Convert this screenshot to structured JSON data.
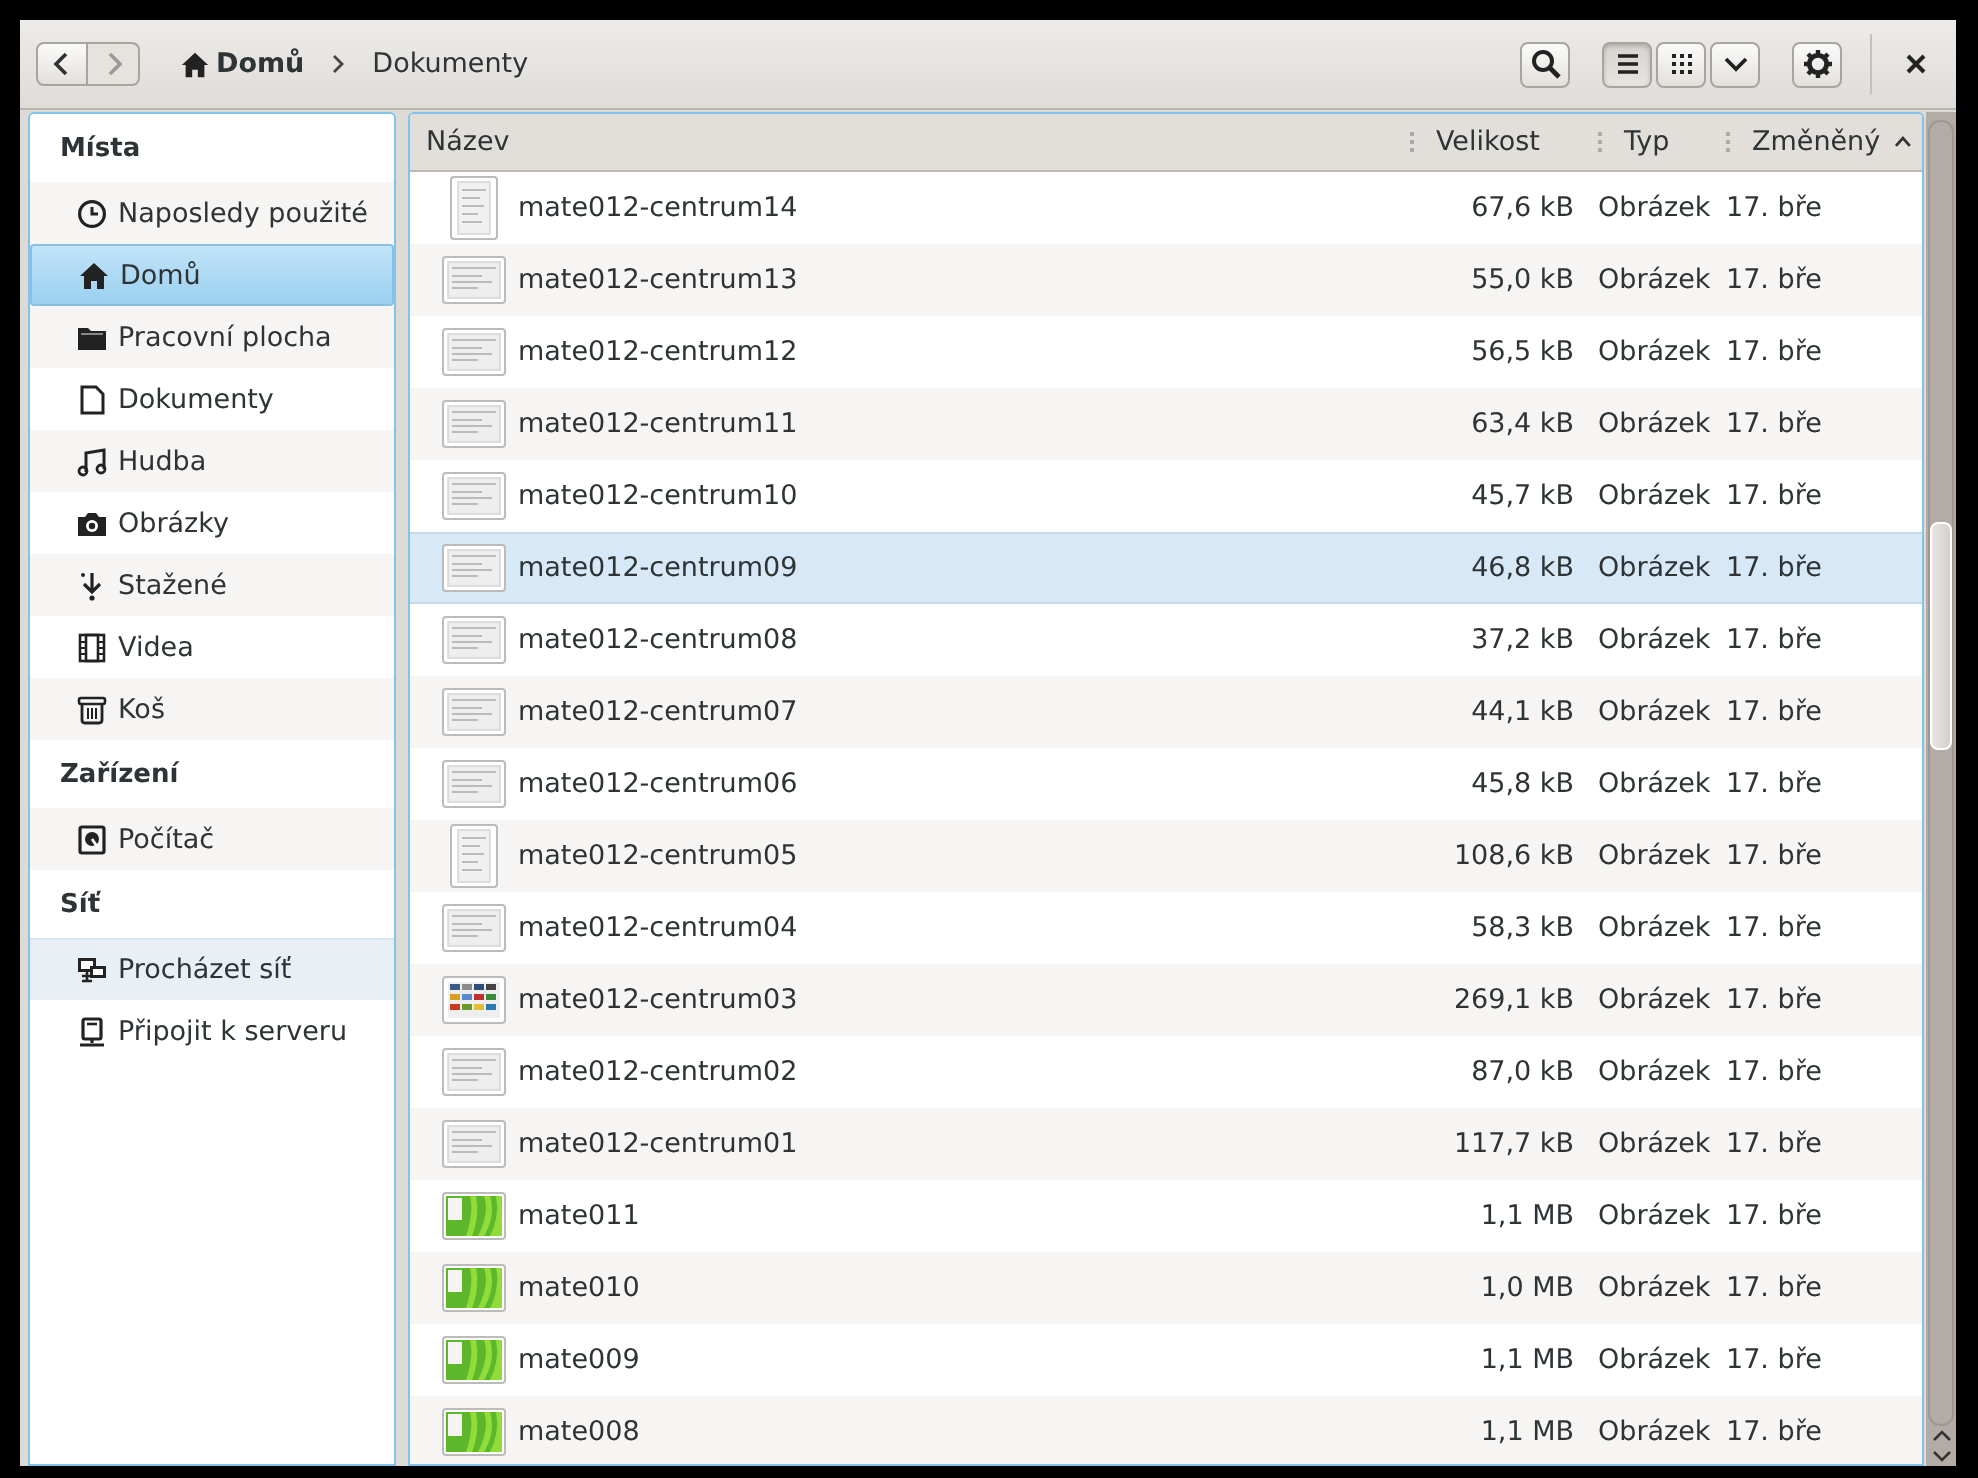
{
  "header": {
    "back": {
      "disabled": false
    },
    "forward": {
      "disabled": true
    },
    "path": [
      {
        "label": "Domů",
        "kind": "home",
        "selected": true
      },
      {
        "label": "Dokumenty",
        "kind": "folder",
        "selected": false
      }
    ],
    "tools": [
      {
        "kind": "search",
        "selected": false
      },
      {
        "kind": "list",
        "selected": true
      },
      {
        "kind": "grid",
        "selected": false
      },
      {
        "kind": "menu",
        "selected": false
      },
      {
        "kind": "gear",
        "selected": false
      }
    ],
    "close": {
      "kind": "close"
    }
  },
  "sidebar": {
    "sections": [
      {
        "title": "Místa",
        "items": [
          {
            "label": "Naposledy použité",
            "kind": "clock",
            "selected": false,
            "hover": false
          },
          {
            "label": "Domů",
            "kind": "home",
            "selected": true,
            "hover": false
          },
          {
            "label": "Pracovní plocha",
            "kind": "folder",
            "selected": false,
            "hover": false
          },
          {
            "label": "Dokumenty",
            "kind": "document",
            "selected": false,
            "hover": false
          },
          {
            "label": "Hudba",
            "kind": "music",
            "selected": false,
            "hover": false
          },
          {
            "label": "Obrázky",
            "kind": "camera",
            "selected": false,
            "hover": false
          },
          {
            "label": "Stažené",
            "kind": "download",
            "selected": false,
            "hover": false
          },
          {
            "label": "Videa",
            "kind": "film",
            "selected": false,
            "hover": false
          },
          {
            "label": "Koš",
            "kind": "trash",
            "selected": false,
            "hover": false
          }
        ]
      },
      {
        "title": "Zařízení",
        "items": [
          {
            "label": "Počítač",
            "kind": "drive",
            "selected": false,
            "hover": false
          }
        ]
      },
      {
        "title": "Síť",
        "items": [
          {
            "label": "Procházet síť",
            "kind": "network",
            "selected": false,
            "hover": true
          },
          {
            "label": "Připojit k serveru",
            "kind": "server",
            "selected": false,
            "hover": false
          }
        ]
      }
    ]
  },
  "table": {
    "columns": [
      {
        "label": "Název",
        "sorted": false
      },
      {
        "label": "Velikost",
        "sorted": false
      },
      {
        "label": "Typ",
        "sorted": false
      },
      {
        "label": "Změněný",
        "sorted": true
      }
    ],
    "rows": [
      {
        "name": "mate012-centrum14",
        "size": "67,6 kB",
        "type": "Obrázek",
        "modified": "17. bře",
        "kind": "portrait",
        "selected": false
      },
      {
        "name": "mate012-centrum13",
        "size": "55,0 kB",
        "type": "Obrázek",
        "modified": "17. bře",
        "kind": "window",
        "selected": false
      },
      {
        "name": "mate012-centrum12",
        "size": "56,5 kB",
        "type": "Obrázek",
        "modified": "17. bře",
        "kind": "window",
        "selected": false
      },
      {
        "name": "mate012-centrum11",
        "size": "63,4 kB",
        "type": "Obrázek",
        "modified": "17. bře",
        "kind": "window",
        "selected": false
      },
      {
        "name": "mate012-centrum10",
        "size": "45,7 kB",
        "type": "Obrázek",
        "modified": "17. bře",
        "kind": "window",
        "selected": false
      },
      {
        "name": "mate012-centrum09",
        "size": "46,8 kB",
        "type": "Obrázek",
        "modified": "17. bře",
        "kind": "window",
        "selected": true
      },
      {
        "name": "mate012-centrum08",
        "size": "37,2 kB",
        "type": "Obrázek",
        "modified": "17. bře",
        "kind": "window",
        "selected": false
      },
      {
        "name": "mate012-centrum07",
        "size": "44,1 kB",
        "type": "Obrázek",
        "modified": "17. bře",
        "kind": "window",
        "selected": false
      },
      {
        "name": "mate012-centrum06",
        "size": "45,8 kB",
        "type": "Obrázek",
        "modified": "17. bře",
        "kind": "window",
        "selected": false
      },
      {
        "name": "mate012-centrum05",
        "size": "108,6 kB",
        "type": "Obrázek",
        "modified": "17. bře",
        "kind": "portrait",
        "selected": false
      },
      {
        "name": "mate012-centrum04",
        "size": "58,3 kB",
        "type": "Obrázek",
        "modified": "17. bře",
        "kind": "window",
        "selected": false
      },
      {
        "name": "mate012-centrum03",
        "size": "269,1 kB",
        "type": "Obrázek",
        "modified": "17. bře",
        "kind": "colorful",
        "selected": false
      },
      {
        "name": "mate012-centrum02",
        "size": "87,0 kB",
        "type": "Obrázek",
        "modified": "17. bře",
        "kind": "window",
        "selected": false
      },
      {
        "name": "mate012-centrum01",
        "size": "117,7 kB",
        "type": "Obrázek",
        "modified": "17. bře",
        "kind": "window",
        "selected": false
      },
      {
        "name": "mate011",
        "size": "1,1 MB",
        "type": "Obrázek",
        "modified": "17. bře",
        "kind": "green",
        "selected": false
      },
      {
        "name": "mate010",
        "size": "1,0 MB",
        "type": "Obrázek",
        "modified": "17. bře",
        "kind": "green",
        "selected": false
      },
      {
        "name": "mate009",
        "size": "1,1 MB",
        "type": "Obrázek",
        "modified": "17. bře",
        "kind": "green",
        "selected": false
      },
      {
        "name": "mate008",
        "size": "1,1 MB",
        "type": "Obrázek",
        "modified": "17. bře",
        "kind": "green",
        "selected": false
      }
    ]
  }
}
